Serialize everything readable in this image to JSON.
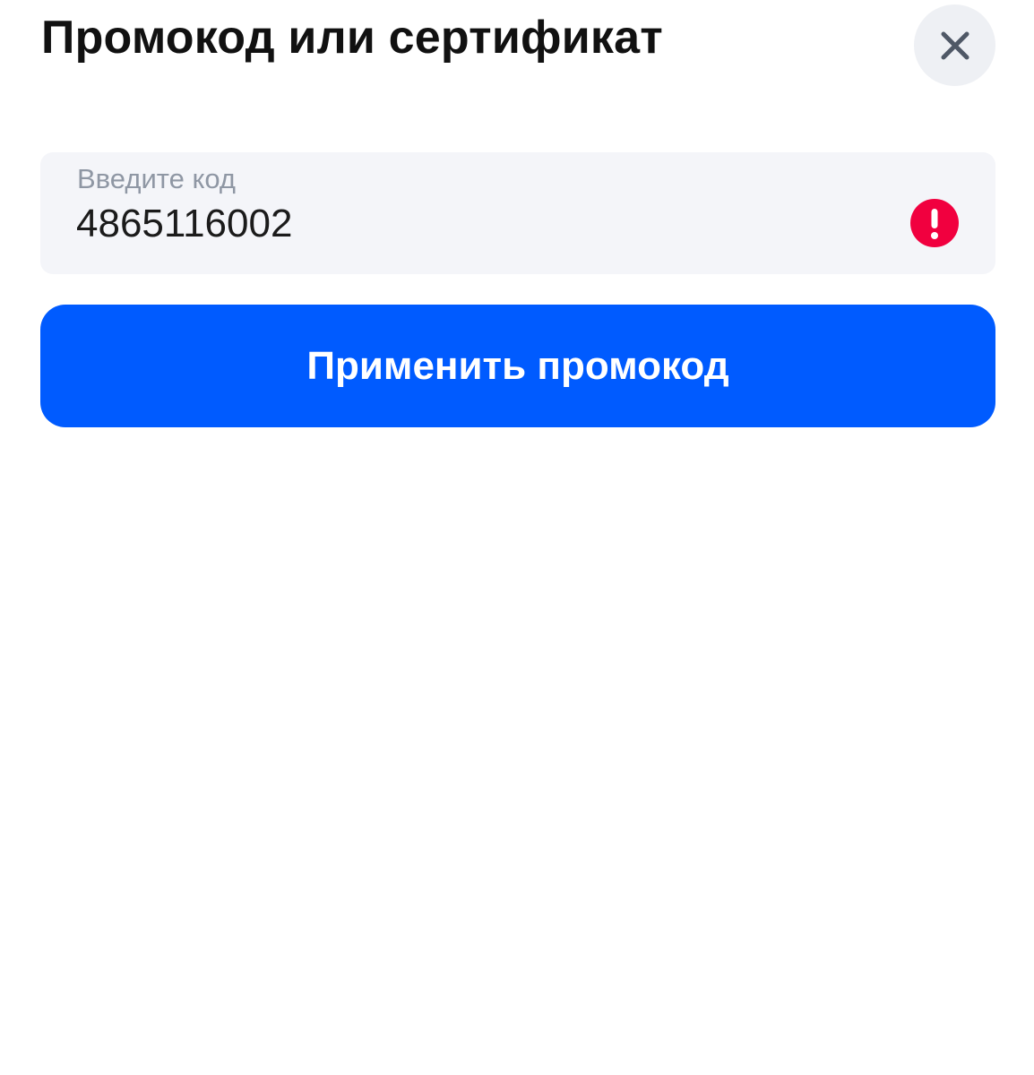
{
  "dialog": {
    "title": "Промокод или сертификат",
    "close_icon": "close-icon"
  },
  "code_field": {
    "label": "Введите код",
    "value": "4865116002",
    "status_icon": "error-exclamation-icon",
    "status": "error"
  },
  "apply_button": {
    "label": "Применить промокод"
  },
  "colors": {
    "accent": "#005bff",
    "error": "#f1003f",
    "field_background": "#f4f5f9",
    "close_background": "#eef0f4",
    "label_text": "#8f97a4"
  }
}
